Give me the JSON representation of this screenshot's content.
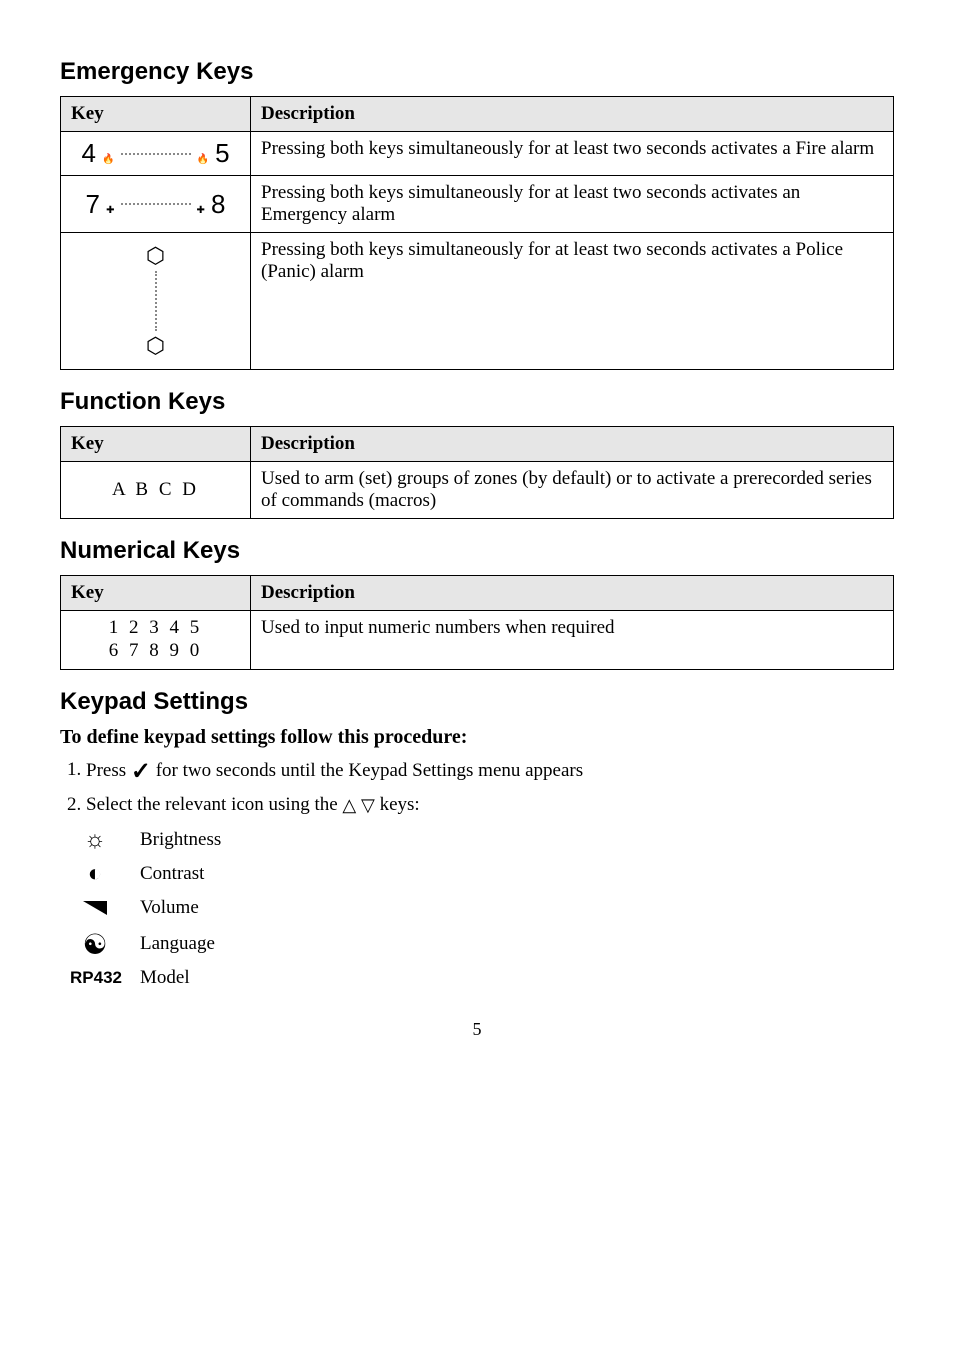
{
  "sections": {
    "emergency": {
      "title": "Emergency Keys",
      "header_key": "Key",
      "header_desc": "Description",
      "rows": [
        {
          "key_left": "4",
          "key_right": "5",
          "desc": "Pressing both keys simultaneously for at least two seconds activates a Fire alarm"
        },
        {
          "key_left": "7",
          "key_right": "8",
          "desc": "Pressing both keys simultaneously for at least two seconds activates an Emergency alarm"
        },
        {
          "desc": "Pressing both keys simultaneously for at least two seconds activates a Police (Panic) alarm"
        }
      ]
    },
    "function": {
      "title": "Function Keys",
      "header_key": "Key",
      "header_desc": "Description",
      "rows": [
        {
          "key": "A B C D",
          "desc": "Used to arm (set) groups of zones (by default) or to activate a prerecorded series of commands (macros)"
        }
      ]
    },
    "numerical": {
      "title": "Numerical Keys",
      "header_key": "Key",
      "header_desc": "Description",
      "rows": [
        {
          "key_line1": "1 2 3 4 5",
          "key_line2": "6 7 8 9 0",
          "desc": "Used to input numeric numbers when required"
        }
      ]
    },
    "keypad": {
      "title": "Keypad Settings",
      "procedure_title": "To define keypad settings follow this procedure:",
      "step1_pre": "Press ",
      "step1_post": " for two seconds until the Keypad Settings menu appears",
      "step2_pre": "Select the relevant icon using the ",
      "step2_post": " keys:",
      "options": {
        "brightness": "Brightness",
        "contrast": "Contrast",
        "volume": "Volume",
        "language": "Language",
        "model_key": "RP432",
        "model_label": "Model"
      }
    }
  },
  "page_number": "5"
}
